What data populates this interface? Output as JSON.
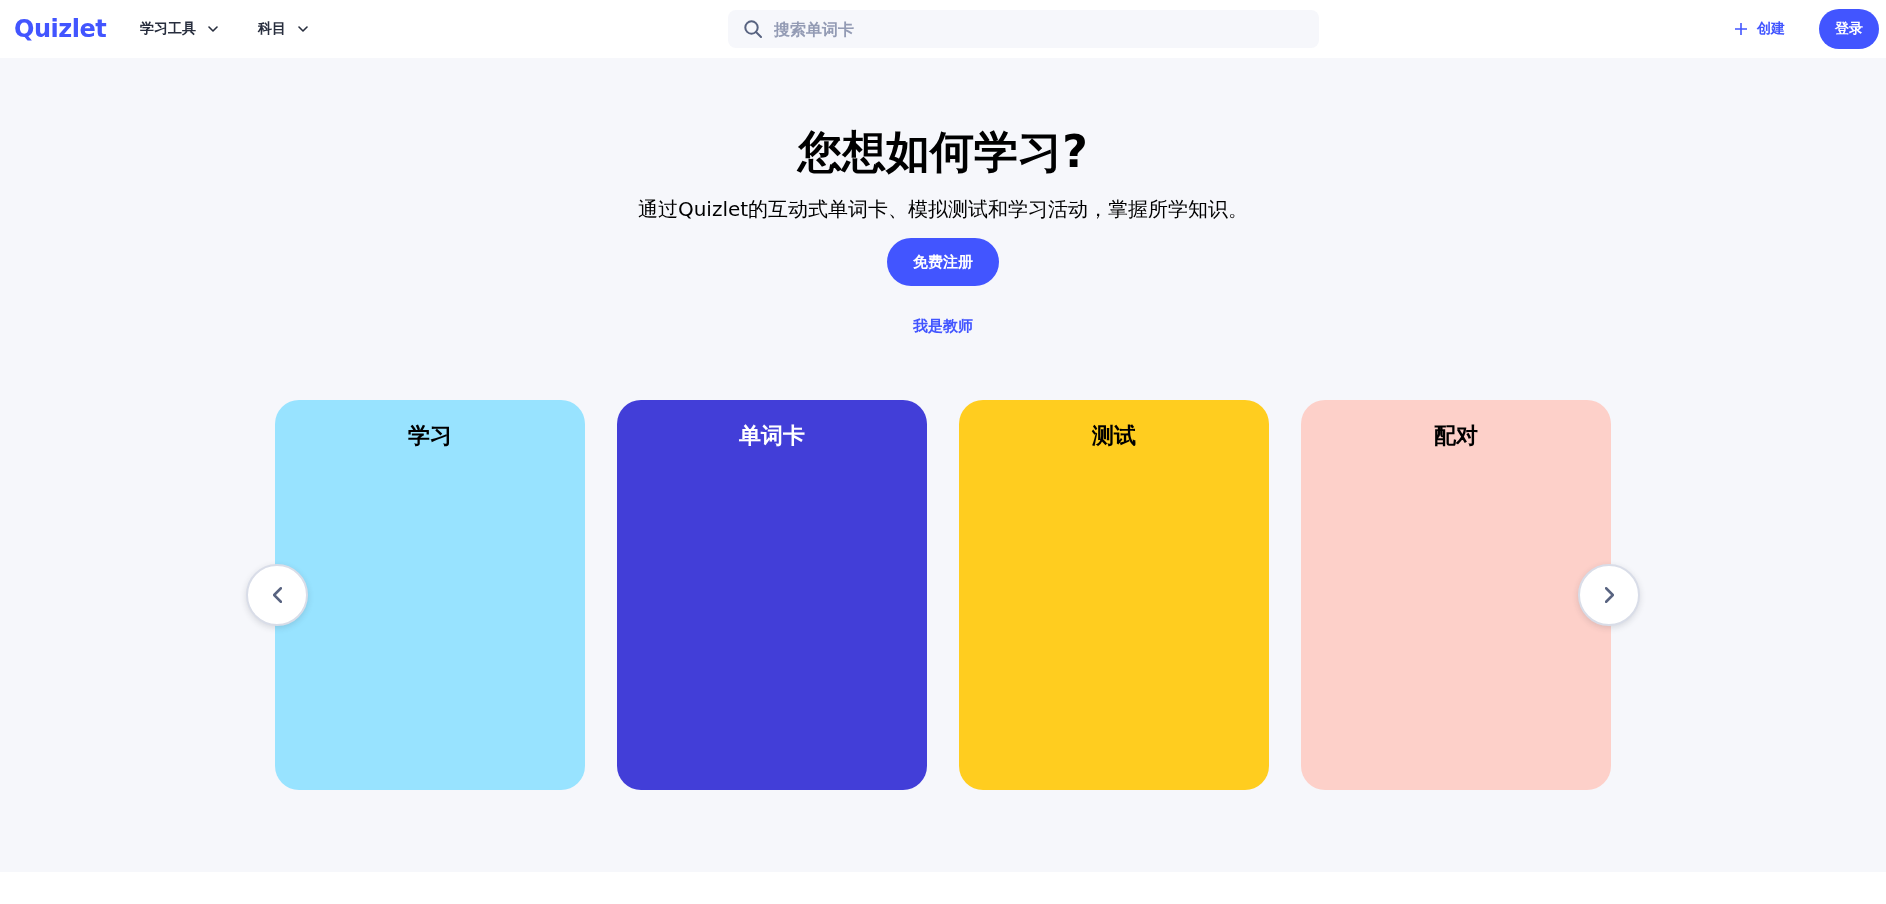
{
  "header": {
    "logo": "Quizlet",
    "nav": [
      {
        "label": "学习工具"
      },
      {
        "label": "科目"
      }
    ],
    "search": {
      "placeholder": "搜索单词卡"
    },
    "create": "创建",
    "login": "登录"
  },
  "hero": {
    "title": "您想如何学习?",
    "subtitle": "通过Quizlet的互动式单词卡、模拟测试和学习活动，掌握所学知识。",
    "signup": "免费注册",
    "teacher_link": "我是教师"
  },
  "carousel": {
    "cards": [
      {
        "title": "学习",
        "color": "#98e3ff"
      },
      {
        "title": "单词卡",
        "color": "#423ed8"
      },
      {
        "title": "测试",
        "color": "#ffcd1f"
      },
      {
        "title": "配对",
        "color": "#fdd0c9"
      }
    ]
  }
}
